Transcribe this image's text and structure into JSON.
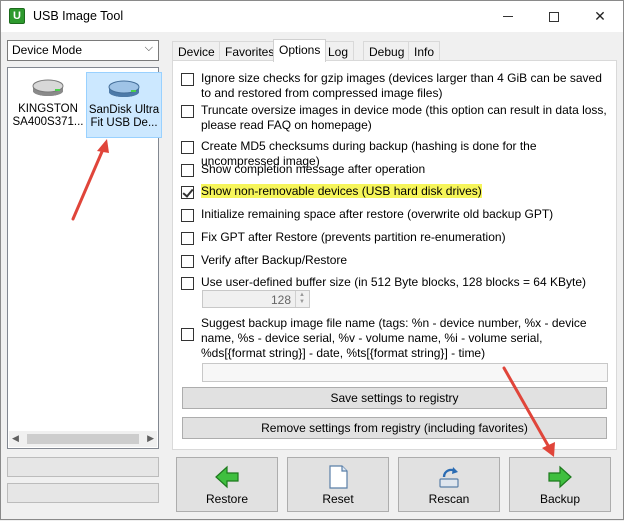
{
  "window": {
    "title": "USB Image Tool",
    "app_icon_letter": "U"
  },
  "mode_select": {
    "value": "Device Mode"
  },
  "devices": [
    {
      "line1": "KINGSTON",
      "line2": "SA400S371...",
      "icon": "hard-drive-icon",
      "selected": false
    },
    {
      "line1": "SanDisk Ultra",
      "line2": "Fit USB De...",
      "icon": "usb-drive-icon",
      "selected": true
    }
  ],
  "tabs": [
    {
      "label": "Device",
      "active": false
    },
    {
      "label": "Favorites",
      "active": false
    },
    {
      "label": "Options",
      "active": true
    },
    {
      "label": "Log",
      "active": false
    },
    {
      "label": "Debug",
      "active": false
    },
    {
      "label": "Info",
      "active": false
    }
  ],
  "options": [
    {
      "label": "Ignore size checks for gzip images (devices larger than 4 GiB can be saved to and restored from compressed image files)",
      "checked": false
    },
    {
      "label": "Truncate oversize images in device mode (this option can result in data loss, please read FAQ on homepage)",
      "checked": false
    },
    {
      "label": "Create MD5 checksums during backup (hashing is done for the uncompressed image)",
      "checked": false
    },
    {
      "label": "Show completion message after operation",
      "checked": false
    },
    {
      "label": "Show non-removable devices (USB hard disk drives)",
      "checked": true,
      "highlighted": true
    },
    {
      "label": "Initialize remaining space after restore (overwrite old backup GPT)",
      "checked": false
    },
    {
      "label": "Fix GPT after Restore (prevents partition re-enumeration)",
      "checked": false
    },
    {
      "label": "Verify after Backup/Restore",
      "checked": false
    },
    {
      "label": "Use user-defined buffer size (in 512 Byte blocks, 128 blocks = 64 KByte)",
      "checked": false
    },
    {
      "label": "Suggest backup image file name (tags: %n - device number, %x - device name, %s - device serial, %v - volume name, %i - volume serial, %ds[{format string}] - date, %ts[{format string}] - time)",
      "checked": false
    }
  ],
  "buffer_size": {
    "value": "128"
  },
  "file_name_pattern": {
    "value": ""
  },
  "buttons": {
    "save_registry": "Save settings to registry",
    "remove_registry": "Remove settings from registry (including favorites)",
    "restore": "Restore",
    "reset": "Reset",
    "rescan": "Rescan",
    "backup": "Backup"
  },
  "colors": {
    "highlight": "#f6f55a",
    "annotation_arrow": "#e0453a",
    "selection": "#cce8ff"
  }
}
